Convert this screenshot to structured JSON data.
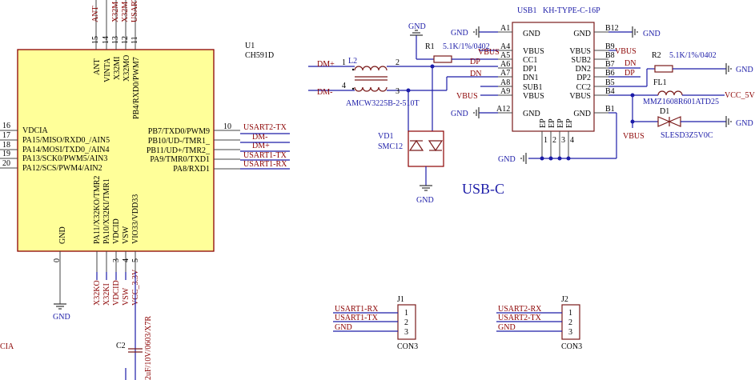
{
  "u1": {
    "designator": "U1",
    "part": "CH591D",
    "left_pins": [
      {
        "num": "16",
        "name": "VDCIA"
      },
      {
        "num": "17",
        "name": "PA15/MISO/RXD0_/AIN5"
      },
      {
        "num": "18",
        "name": "PA14/MOSI/TXD0_/AIN4"
      },
      {
        "num": "19",
        "name": "PA13/SCK0/PWM5/AIN3"
      },
      {
        "num": "20",
        "name": "PA12/SCS/PWM4/AIN2"
      }
    ],
    "right_pins": [
      {
        "num": "10",
        "name": "PB7/TXD0/PWM9",
        "net": "USART2-TX"
      },
      {
        "num": "",
        "name": "PB10/UD-/TMR1_",
        "net": "DM-"
      },
      {
        "num": "",
        "name": "PB11/UD+/TMR2_",
        "net": "DM+"
      },
      {
        "num": "",
        "name": "PA9/TMR0/TXD1",
        "net": "USART1-TX"
      },
      {
        "num": "",
        "name": "PA8/RXD1",
        "net": "USART1-RX"
      }
    ],
    "top_pins": [
      {
        "num": "15",
        "name": "ANT",
        "net": "ANT"
      },
      {
        "num": "14",
        "name": "VINTA",
        "net": "X32M"
      },
      {
        "num": "13",
        "name": "X32MI",
        "net": "X32M"
      },
      {
        "num": "12",
        "name": "X32MO",
        "net": "USART"
      },
      {
        "num": "11",
        "name": "PB4/RXD0/PWM7",
        "net": ""
      }
    ],
    "bottom_pins": [
      {
        "num": "0",
        "name": "GND",
        "net": ""
      },
      {
        "num": "",
        "name": "PA11/X32KO/TMR2",
        "net": "X32KO"
      },
      {
        "num": "",
        "name": "PA10/X32KI/TMR1",
        "net": "X32KI"
      },
      {
        "num": "3",
        "name": "VDCID",
        "net": "VDCID"
      },
      {
        "num": "4",
        "name": "VSW",
        "net": "VSW"
      },
      {
        "num": "5",
        "name": "VIO33/VDD33",
        "net": "VCC_3.3V"
      }
    ]
  },
  "usb1": {
    "designator": "USB1",
    "part": "KH-TYPE-C-16P",
    "left_pins": [
      {
        "num": "A1",
        "name": "GND"
      },
      {
        "num": "A4",
        "name": "VBUS"
      },
      {
        "num": "A5",
        "name": "CC1"
      },
      {
        "num": "A6",
        "name": "DP1"
      },
      {
        "num": "A7",
        "name": "DN1"
      },
      {
        "num": "A8",
        "name": "SUB1"
      },
      {
        "num": "A9",
        "name": "VBUS"
      },
      {
        "num": "A12",
        "name": "GND"
      }
    ],
    "right_pins": [
      {
        "num": "B12",
        "name": "GND"
      },
      {
        "num": "B9",
        "name": "VBUS"
      },
      {
        "num": "B8",
        "name": "SUB2"
      },
      {
        "num": "B7",
        "name": "DN2"
      },
      {
        "num": "B6",
        "name": "DP2"
      },
      {
        "num": "B5",
        "name": "CC2"
      },
      {
        "num": "B4",
        "name": "VBUS"
      },
      {
        "num": "B1",
        "name": "GND"
      }
    ],
    "bottom_pins": [
      "EP",
      "EP",
      "EP",
      "EP"
    ],
    "bottom_nums": [
      "1",
      "2",
      "3",
      "4"
    ]
  },
  "r1": {
    "designator": "R1",
    "value": "5.1K/1%/0402"
  },
  "r2": {
    "designator": "R2",
    "value": "5.1K/1%/0402"
  },
  "l2": {
    "designator": "L2",
    "part": "AMCW3225B-2-510T",
    "pins": [
      "1",
      "2",
      "4",
      "3"
    ]
  },
  "vd1": {
    "designator": "VD1",
    "part": "SMC12"
  },
  "fl1": {
    "designator": "FL1",
    "part": "MMZ1608R601ATD25"
  },
  "d1": {
    "designator": "D1",
    "part": "SLESD3Z5V0C"
  },
  "c2": {
    "designator": "C2",
    "value": "2uF/10V/0603/X7R"
  },
  "j1": {
    "designator": "J1",
    "part": "CON3",
    "pins": [
      "1",
      "2",
      "3"
    ],
    "nets": [
      "USART1-RX",
      "USART1-TX",
      "GND"
    ]
  },
  "j2": {
    "designator": "J2",
    "part": "CON3",
    "pins": [
      "1",
      "2",
      "3"
    ],
    "nets": [
      "USART2-RX",
      "USART2-TX",
      "GND"
    ]
  },
  "section_title": "USB-C",
  "nets": {
    "dm_plus": "DM+",
    "dm_minus": "DM-",
    "dp": "DP",
    "dn": "DN",
    "vbus": "VBUS",
    "vcc5v": "VCC_5V",
    "gnd": "GND",
    "vdcia_frag": "CIA"
  }
}
